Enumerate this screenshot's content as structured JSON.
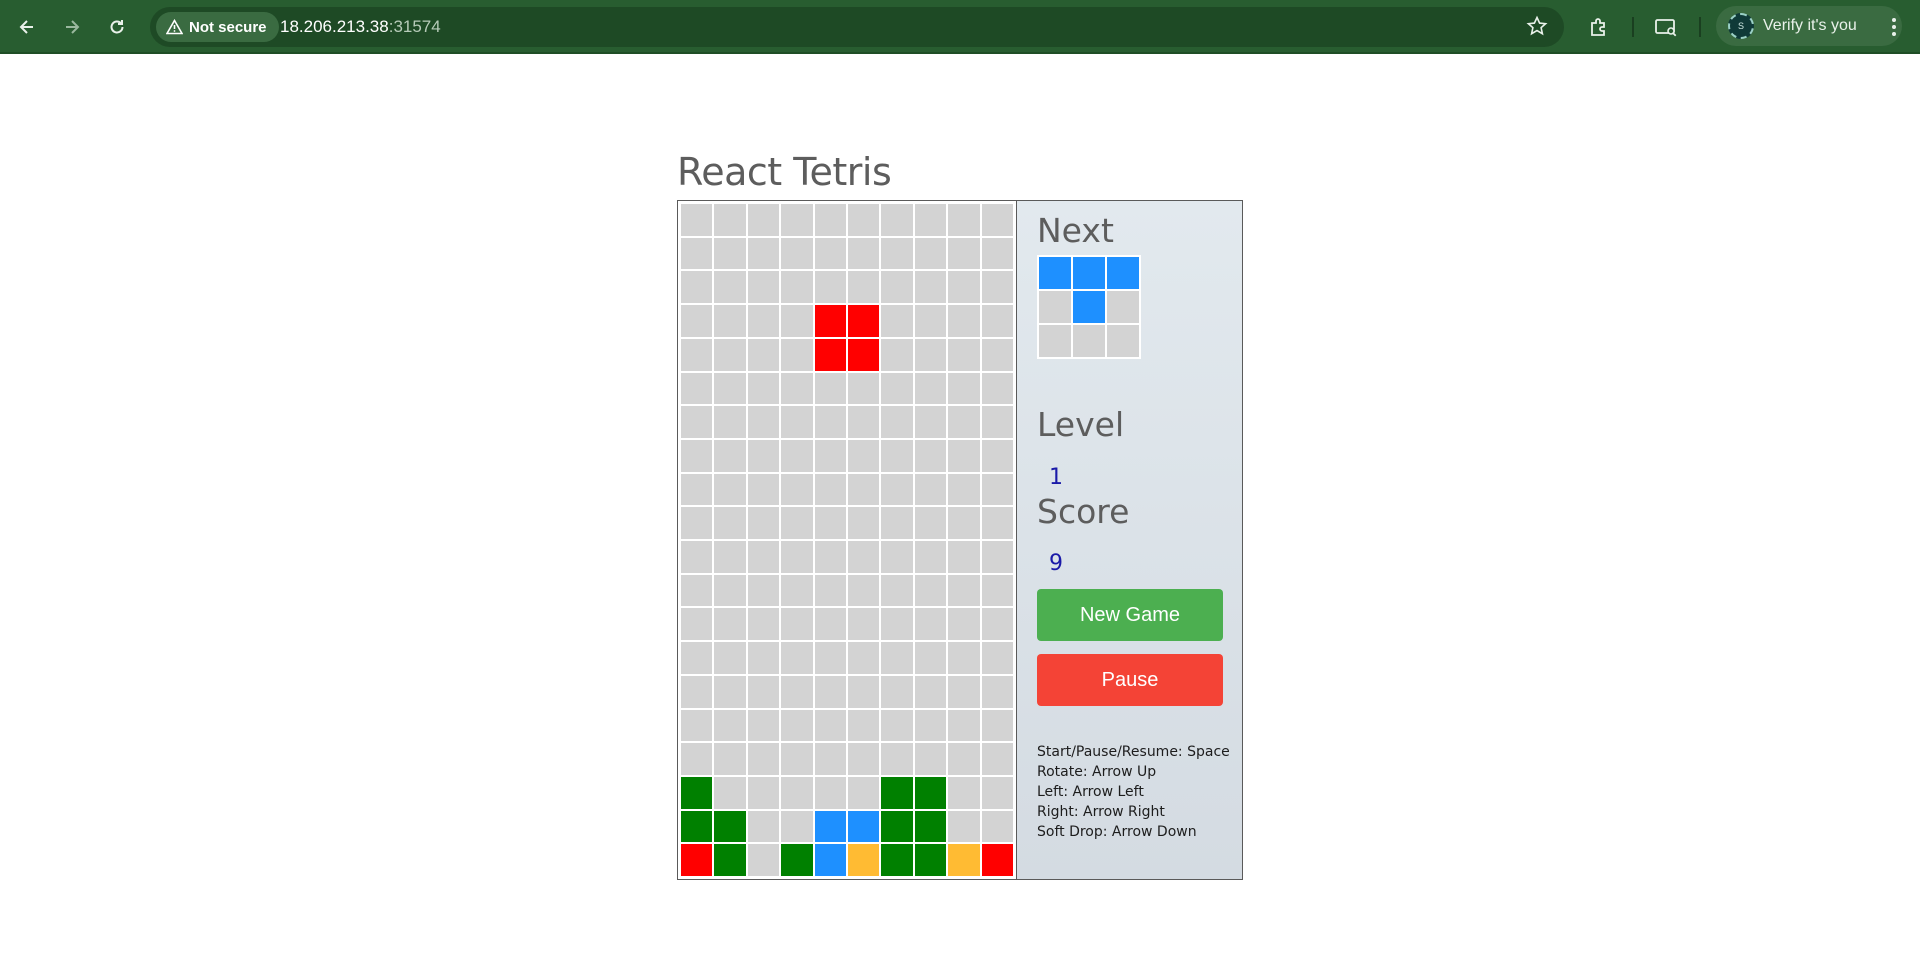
{
  "browser": {
    "security_label": "Not secure",
    "url_host": "18.206.213.38",
    "url_port": ":31574",
    "profile_label": "Verify it's you",
    "avatar_letter": "S",
    "icons": [
      "back-icon",
      "forward-icon",
      "reload-icon",
      "warning-icon",
      "star-icon",
      "extensions-icon",
      "cast-icon",
      "menu-icon"
    ]
  },
  "app": {
    "title": "React Tetris"
  },
  "colors": {
    "empty": "#d3d3d3",
    "R": "#ff0000",
    "G": "#008000",
    "B": "#1e90ff",
    "Y": "#ffbb33"
  },
  "board": {
    "columns": 10,
    "rows": [
      "..........",
      "..........",
      "..........",
      "....RR....",
      "....RR....",
      "..........",
      "..........",
      "..........",
      "..........",
      "..........",
      "..........",
      "..........",
      "..........",
      "..........",
      "..........",
      "..........",
      "..........",
      "G.....GG..",
      "GG..BBGG..",
      "RG.GBYGGYR"
    ]
  },
  "side_panel": {
    "next_label": "Next",
    "next_piece": [
      "BBB",
      ".B.",
      "..."
    ],
    "level_label": "Level",
    "level_value": "1",
    "score_label": "Score",
    "score_value": "9",
    "new_game_label": "New Game",
    "pause_label": "Pause",
    "controls": [
      "Start/Pause/Resume: Space",
      "Rotate: Arrow Up",
      "Left: Arrow Left",
      "Right: Arrow Right",
      "Soft Drop: Arrow Down"
    ]
  }
}
